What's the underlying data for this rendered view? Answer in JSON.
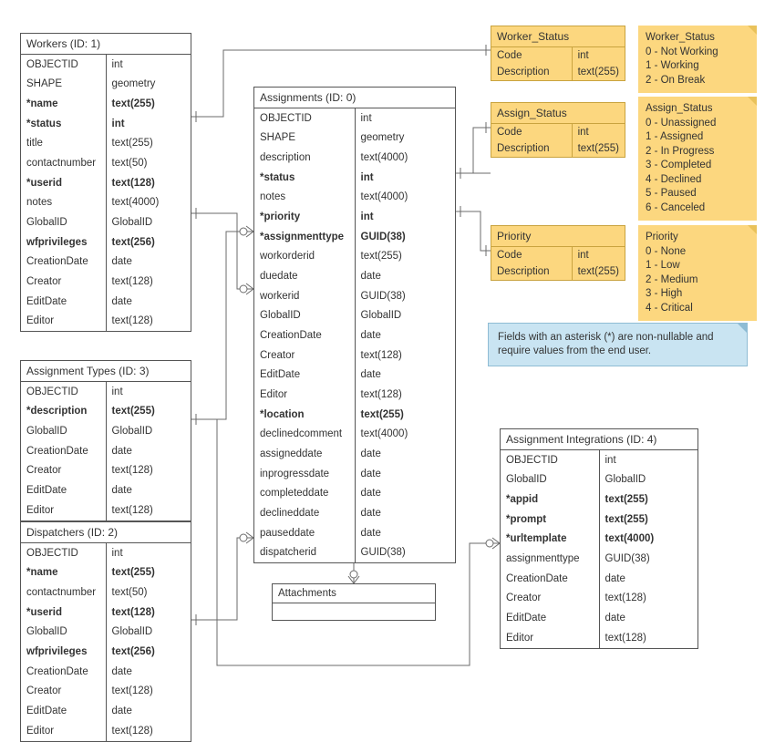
{
  "entities": {
    "workers": {
      "title": "Workers (ID: 1)",
      "fields": [
        {
          "n": "OBJECTID",
          "t": "int",
          "b": false
        },
        {
          "n": "SHAPE",
          "t": "geometry",
          "b": false
        },
        {
          "n": "*name",
          "t": "text(255)",
          "b": true
        },
        {
          "n": "*status",
          "t": "int",
          "b": true
        },
        {
          "n": "title",
          "t": "text(255)",
          "b": false
        },
        {
          "n": "contactnumber",
          "t": "text(50)",
          "b": false
        },
        {
          "n": "*userid",
          "t": "text(128)",
          "b": true
        },
        {
          "n": "notes",
          "t": "text(4000)",
          "b": false
        },
        {
          "n": "GlobalID",
          "t": "GlobalID",
          "b": false
        },
        {
          "n": "wfprivileges",
          "t": "text(256)",
          "b": true
        },
        {
          "n": "CreationDate",
          "t": "date",
          "b": false
        },
        {
          "n": "Creator",
          "t": "text(128)",
          "b": false
        },
        {
          "n": "EditDate",
          "t": "date",
          "b": false
        },
        {
          "n": "Editor",
          "t": "text(128)",
          "b": false
        }
      ]
    },
    "assignments": {
      "title": "Assignments (ID: 0)",
      "fields": [
        {
          "n": "OBJECTID",
          "t": "int",
          "b": false
        },
        {
          "n": "SHAPE",
          "t": "geometry",
          "b": false
        },
        {
          "n": "description",
          "t": "text(4000)",
          "b": false
        },
        {
          "n": "*status",
          "t": "int",
          "b": true
        },
        {
          "n": "notes",
          "t": "text(4000)",
          "b": false
        },
        {
          "n": "*priority",
          "t": "int",
          "b": true
        },
        {
          "n": "*assignmenttype",
          "t": "GUID(38)",
          "b": true
        },
        {
          "n": "workorderid",
          "t": "text(255)",
          "b": false
        },
        {
          "n": "duedate",
          "t": "date",
          "b": false
        },
        {
          "n": "workerid",
          "t": "GUID(38)",
          "b": false
        },
        {
          "n": "GlobalID",
          "t": "GlobalID",
          "b": false
        },
        {
          "n": "CreationDate",
          "t": "date",
          "b": false
        },
        {
          "n": "Creator",
          "t": "text(128)",
          "b": false
        },
        {
          "n": "EditDate",
          "t": "date",
          "b": false
        },
        {
          "n": "Editor",
          "t": "text(128)",
          "b": false
        },
        {
          "n": "*location",
          "t": "text(255)",
          "b": true
        },
        {
          "n": "declinedcomment",
          "t": "text(4000)",
          "b": false
        },
        {
          "n": "assigneddate",
          "t": "date",
          "b": false
        },
        {
          "n": "inprogressdate",
          "t": "date",
          "b": false
        },
        {
          "n": "completeddate",
          "t": "date",
          "b": false
        },
        {
          "n": "declineddate",
          "t": "date",
          "b": false
        },
        {
          "n": "pauseddate",
          "t": "date",
          "b": false
        },
        {
          "n": "dispatcherid",
          "t": "GUID(38)",
          "b": false
        }
      ]
    },
    "atypes": {
      "title": "Assignment Types (ID: 3)",
      "fields": [
        {
          "n": "OBJECTID",
          "t": "int",
          "b": false
        },
        {
          "n": "*description",
          "t": "text(255)",
          "b": true
        },
        {
          "n": "GlobalID",
          "t": "GlobalID",
          "b": false
        },
        {
          "n": "CreationDate",
          "t": "date",
          "b": false
        },
        {
          "n": "Creator",
          "t": "text(128)",
          "b": false
        },
        {
          "n": "EditDate",
          "t": "date",
          "b": false
        },
        {
          "n": "Editor",
          "t": "text(128)",
          "b": false
        }
      ]
    },
    "dispatchers": {
      "title": "Dispatchers (ID: 2)",
      "fields": [
        {
          "n": "OBJECTID",
          "t": "int",
          "b": false
        },
        {
          "n": "*name",
          "t": "text(255)",
          "b": true
        },
        {
          "n": "contactnumber",
          "t": "text(50)",
          "b": false
        },
        {
          "n": "*userid",
          "t": "text(128)",
          "b": true
        },
        {
          "n": "GlobalID",
          "t": "GlobalID",
          "b": false
        },
        {
          "n": "wfprivileges",
          "t": "text(256)",
          "b": true
        },
        {
          "n": "CreationDate",
          "t": "date",
          "b": false
        },
        {
          "n": "Creator",
          "t": "text(128)",
          "b": false
        },
        {
          "n": "EditDate",
          "t": "date",
          "b": false
        },
        {
          "n": "Editor",
          "t": "text(128)",
          "b": false
        }
      ]
    },
    "aint": {
      "title": "Assignment Integrations (ID: 4)",
      "fields": [
        {
          "n": "OBJECTID",
          "t": "int",
          "b": false
        },
        {
          "n": "GlobalID",
          "t": "GlobalID",
          "b": false
        },
        {
          "n": "*appid",
          "t": "text(255)",
          "b": true
        },
        {
          "n": "*prompt",
          "t": "text(255)",
          "b": true
        },
        {
          "n": "*urltemplate",
          "t": "text(4000)",
          "b": true
        },
        {
          "n": "assignmenttype",
          "t": "GUID(38)",
          "b": false
        },
        {
          "n": "CreationDate",
          "t": "date",
          "b": false
        },
        {
          "n": "Creator",
          "t": "text(128)",
          "b": false
        },
        {
          "n": "EditDate",
          "t": "date",
          "b": false
        },
        {
          "n": "Editor",
          "t": "text(128)",
          "b": false
        }
      ]
    }
  },
  "lookups": {
    "wstatus": {
      "title": "Worker_Status",
      "rows": [
        {
          "n": "Code",
          "t": "int"
        },
        {
          "n": "Description",
          "t": "text(255)"
        }
      ]
    },
    "astatus": {
      "title": "Assign_Status",
      "rows": [
        {
          "n": "Code",
          "t": "int"
        },
        {
          "n": "Description",
          "t": "text(255)"
        }
      ]
    },
    "priority": {
      "title": "Priority",
      "rows": [
        {
          "n": "Code",
          "t": "int"
        },
        {
          "n": "Description",
          "t": "text(255)"
        }
      ]
    }
  },
  "notes": {
    "wstatus": [
      "Worker_Status",
      "0 - Not Working",
      "1 - Working",
      "2 - On Break"
    ],
    "astatus": [
      "Assign_Status",
      "0 - Unassigned",
      "1 - Assigned",
      "2 - In Progress",
      "3 - Completed",
      "4 - Declined",
      "5 - Paused",
      "6 - Canceled"
    ],
    "priority": [
      "Priority",
      "0 - None",
      "1 - Low",
      "2 - Medium",
      "3 - High",
      "4 - Critical"
    ]
  },
  "callout": "Fields with an asterisk (*) are non-nullable and require values from the end user.",
  "attachments": {
    "title": "Attachments"
  }
}
